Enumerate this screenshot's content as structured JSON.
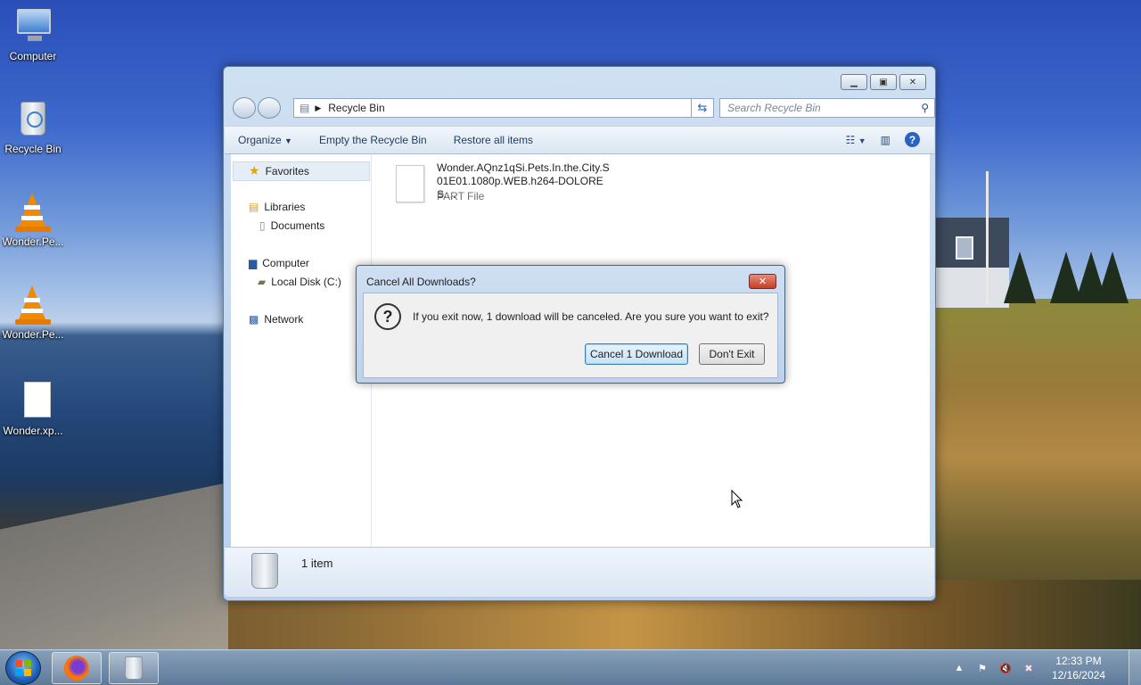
{
  "desktop": {
    "icons": [
      {
        "label": "Computer"
      },
      {
        "label": "Recycle Bin"
      },
      {
        "label": "Wonder.Pe..."
      },
      {
        "label": "Wonder.Pe..."
      },
      {
        "label": "Wonder.xp..."
      }
    ]
  },
  "explorer": {
    "address": "Recycle Bin",
    "search_placeholder": "Search Recycle Bin",
    "toolbar": {
      "organize": "Organize",
      "empty": "Empty the Recycle Bin",
      "restore": "Restore all items"
    },
    "nav": {
      "favorites": "Favorites",
      "libraries": "Libraries",
      "documents": "Documents",
      "computer": "Computer",
      "local_disk": "Local Disk (C:)",
      "network": "Network"
    },
    "file": {
      "name": "Wonder.AQnz1qSi.Pets.In.the.City.S01E01.1080p.WEB.h264-DOLORES....",
      "type": "PART File"
    },
    "status": "1 item"
  },
  "dialog": {
    "title": "Cancel All Downloads?",
    "message": "If you exit now, 1 download will be canceled. Are you sure you want to exit?",
    "primary_button": "Cancel 1 Download",
    "secondary_button": "Don't Exit"
  },
  "taskbar": {
    "time": "12:33 PM",
    "date": "12/16/2024"
  }
}
